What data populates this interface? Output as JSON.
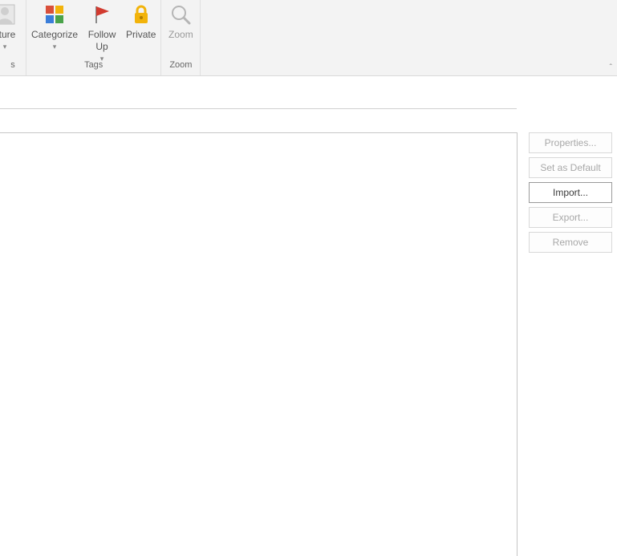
{
  "ribbon": {
    "groups": [
      {
        "name": "partial",
        "label": "s",
        "buttons": [
          {
            "name": "picture-button",
            "label": "cture",
            "dropdown": true,
            "icon": "picture"
          }
        ]
      },
      {
        "name": "tags",
        "label": "Tags",
        "buttons": [
          {
            "name": "categorize-button",
            "label": "Categorize",
            "dropdown": true,
            "icon": "categorize"
          },
          {
            "name": "follow-up-button",
            "label": "Follow\nUp",
            "dropdown": true,
            "icon": "flag"
          },
          {
            "name": "private-button",
            "label": "Private",
            "dropdown": false,
            "icon": "lock"
          }
        ]
      },
      {
        "name": "zoom",
        "label": "Zoom",
        "buttons": [
          {
            "name": "zoom-button",
            "label": "Zoom",
            "dropdown": false,
            "icon": "zoom",
            "disabled": true
          }
        ]
      }
    ],
    "collapse_caret": "ˆ"
  },
  "side_buttons": [
    {
      "name": "properties-button",
      "label": "Properties...",
      "enabled": false
    },
    {
      "name": "set-as-default-button",
      "label": "Set as Default",
      "enabled": false
    },
    {
      "name": "import-button",
      "label": "Import...",
      "enabled": true
    },
    {
      "name": "export-button",
      "label": "Export...",
      "enabled": false
    },
    {
      "name": "remove-button",
      "label": "Remove",
      "enabled": false
    }
  ]
}
